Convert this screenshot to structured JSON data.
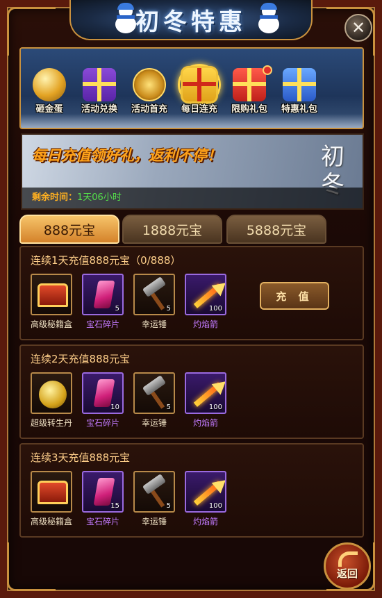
{
  "header": {
    "title": "初冬特惠",
    "close_icon": "close-icon"
  },
  "categories": [
    {
      "label": "砸金蛋",
      "icon": "golden-egg-icon"
    },
    {
      "label": "活动兑换",
      "icon": "gift-box-icon"
    },
    {
      "label": "活动首充",
      "icon": "coins-icon"
    },
    {
      "label": "每日连充",
      "icon": "gift-box-icon",
      "active": true
    },
    {
      "label": "限购礼包",
      "icon": "gift-box-icon"
    },
    {
      "label": "特惠礼包",
      "icon": "gift-box-icon"
    }
  ],
  "promo": {
    "headline": "每日充值领好礼，返利不停！",
    "calligraphy": "初冬",
    "time_label": "剩余时间：",
    "time_value": "1天06小时"
  },
  "tabs": [
    {
      "label": "888元宝",
      "active": true
    },
    {
      "label": "1888元宝",
      "active": false
    },
    {
      "label": "5888元宝",
      "active": false
    }
  ],
  "rows": [
    {
      "title": "连续1天充值888元宝（0/888）",
      "button": "充 值",
      "items": [
        {
          "name": "高级秘籍盒",
          "qty": ""
        },
        {
          "name": "宝石碎片",
          "qty": "5"
        },
        {
          "name": "幸运锤",
          "qty": "5"
        },
        {
          "name": "灼焰箭",
          "qty": "100"
        }
      ]
    },
    {
      "title": "连续2天充值888元宝",
      "items": [
        {
          "name": "超级转生丹",
          "qty": ""
        },
        {
          "name": "宝石碎片",
          "qty": "10"
        },
        {
          "name": "幸运锤",
          "qty": "5"
        },
        {
          "name": "灼焰箭",
          "qty": "100"
        }
      ]
    },
    {
      "title": "连续3天充值888元宝",
      "items": [
        {
          "name": "高级秘籍盒",
          "qty": ""
        },
        {
          "name": "宝石碎片",
          "qty": "15"
        },
        {
          "name": "幸运锤",
          "qty": "5"
        },
        {
          "name": "灼焰箭",
          "qty": "100"
        }
      ]
    }
  ],
  "footer": {
    "back_label": "返回"
  },
  "colors": {
    "accent_gold": "#c9913e",
    "promo_orange": "#ffa31a",
    "time_green": "#54e04a",
    "rare_purple": "#c27aff"
  }
}
